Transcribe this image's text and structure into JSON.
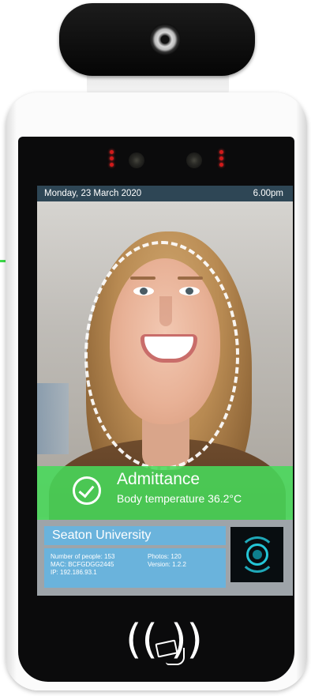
{
  "status_bar": {
    "date": "Monday, 23 March 2020",
    "time": "6.00pm"
  },
  "result": {
    "title": "Admittance",
    "temperature": "Body temperature 36.2°C"
  },
  "organization": {
    "name": "Seaton University"
  },
  "device_info": {
    "people": "Number of people: 153",
    "photos": "Photos: 120",
    "mac": "MAC: BCFGDGG2445",
    "version": "Version: 1.2.2",
    "ip": "IP: 192.186.93.1"
  },
  "nfc": {
    "waves_label": "(( ))",
    "icon": "nfc-card-tap-icon"
  },
  "colors": {
    "accent_green": "#48da5a",
    "info_blue": "#6ab3dc",
    "status_bar": "#2e4655",
    "led_red": "#d11a1a"
  }
}
